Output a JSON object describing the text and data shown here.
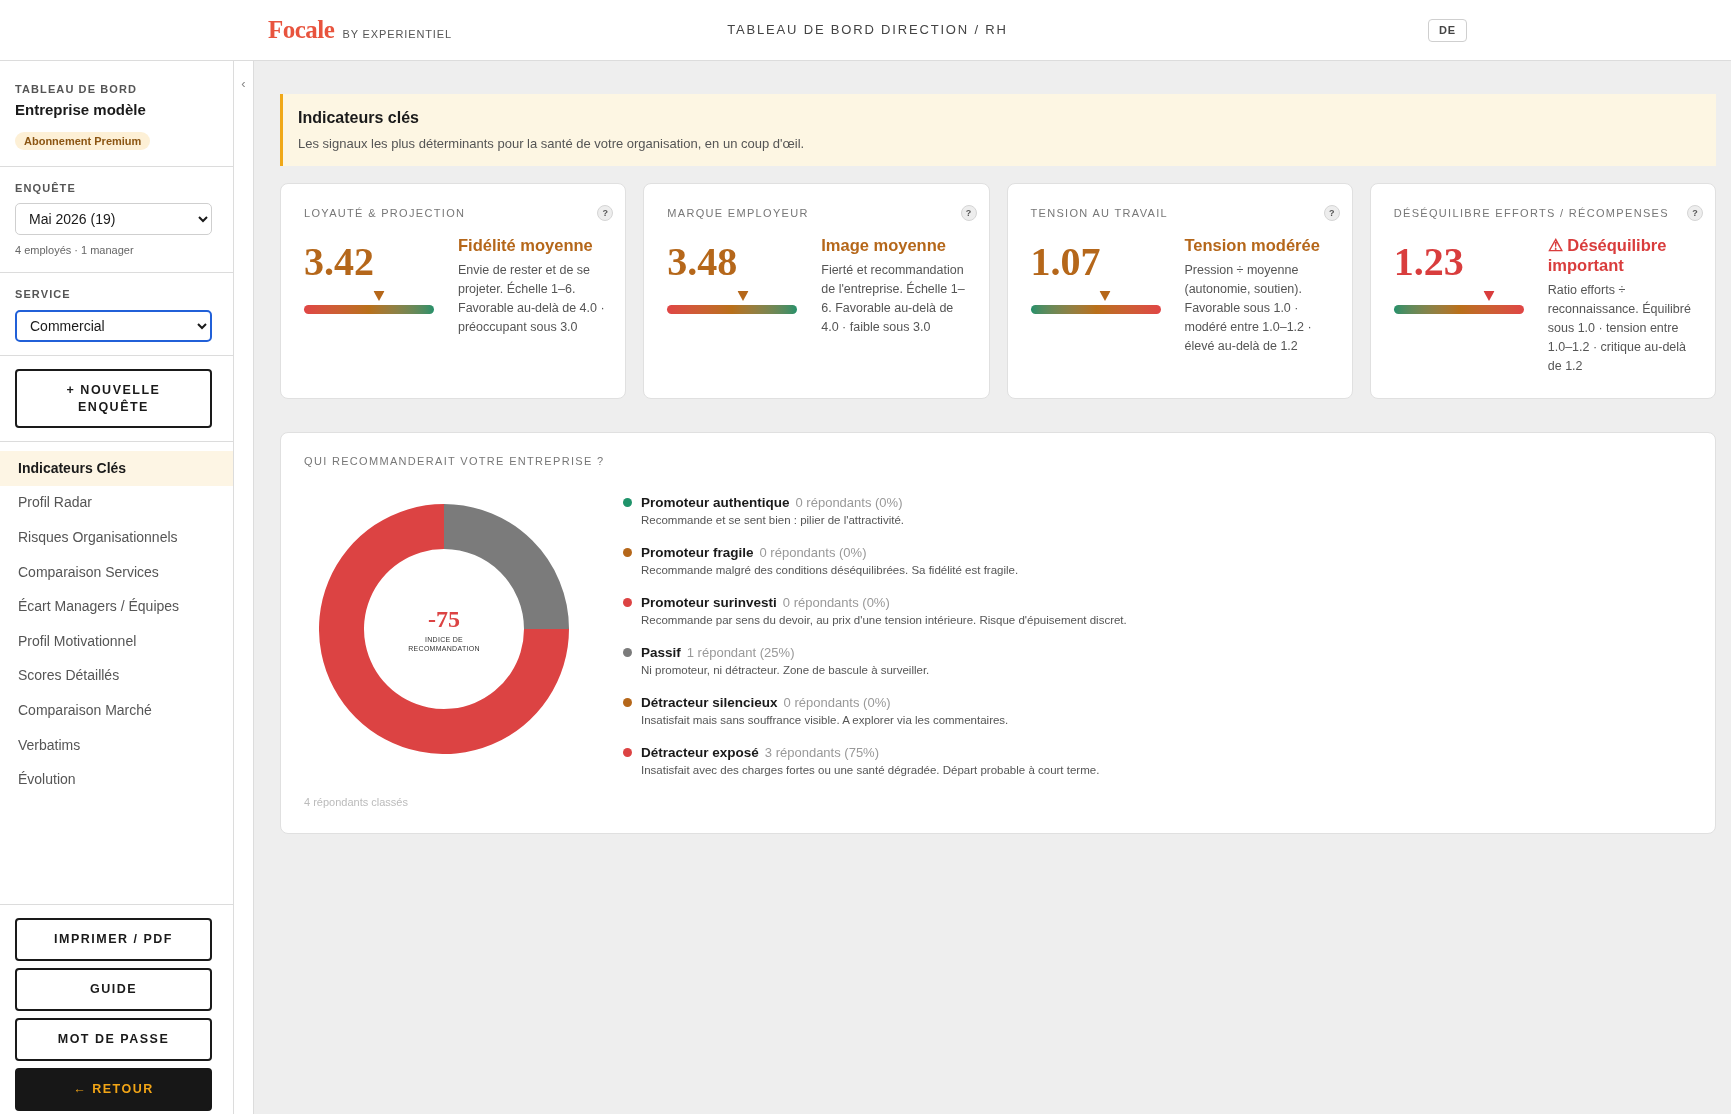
{
  "header": {
    "logo": "Focale",
    "logo_tagline": "BY EXPERIENTIEL",
    "title": "TABLEAU DE BORD DIRECTION / RH",
    "language_button": "DE"
  },
  "sidebar": {
    "eyebrow": "TABLEAU DE BORD",
    "company": "Entreprise modèle",
    "plan_badge": "Abonnement Premium",
    "survey": {
      "label": "ENQUÊTE",
      "value": "Mai 2026 (19)",
      "focused": false,
      "note": "4 employés · 1 manager"
    },
    "service": {
      "label": "SERVICE",
      "value": "Commercial",
      "focused": true
    },
    "new_survey_button": "+ NOUVELLE ENQUÊTE",
    "nav_items": [
      {
        "label": "Indicateurs Clés",
        "selected": true
      },
      {
        "label": "Profil Radar",
        "selected": false
      },
      {
        "label": "Risques Organisationnels",
        "selected": false
      },
      {
        "label": "Comparaison Services",
        "selected": false
      },
      {
        "label": "Écart Managers / Équipes",
        "selected": false
      },
      {
        "label": "Profil Motivationnel",
        "selected": false
      },
      {
        "label": "Scores Détaillés",
        "selected": false
      },
      {
        "label": "Comparaison Marché",
        "selected": false
      },
      {
        "label": "Verbatims",
        "selected": false
      },
      {
        "label": "Évolution",
        "selected": false
      }
    ],
    "actions": [
      {
        "label": "IMPRIMER / PDF",
        "kind": "outline"
      },
      {
        "label": "GUIDE",
        "kind": "outline"
      },
      {
        "label": "MOT DE PASSE",
        "kind": "outline"
      },
      {
        "label": "← RETOUR",
        "kind": "dark"
      }
    ]
  },
  "collapse_toggle": "‹",
  "banner": {
    "title": "Indicateurs clés",
    "subtitle": "Les signaux les plus déterminants pour la santé de votre organisation, en un coup d'œil."
  },
  "cards": [
    {
      "label": "LOYAUTÉ & PROJECTION",
      "help": "?",
      "value": "3.42",
      "status": "Fidélité moyenne",
      "description": "Envie de rester et de se projeter. Échelle 1–6. Favorable au-delà de 4.0 · préoccupant sous 3.0",
      "color": "#b5671a",
      "level": 0.58,
      "kind": "ascending"
    },
    {
      "label": "MARQUE EMPLOYEUR",
      "help": "?",
      "value": "3.48",
      "status": "Image moyenne",
      "description": "Fierté et recommandation de l'entreprise. Échelle 1–6. Favorable au-delà de 4.0 · faible sous 3.0",
      "color": "#b5671a",
      "level": 0.58,
      "kind": "ascending"
    },
    {
      "label": "TENSION AU TRAVAIL",
      "help": "?",
      "value": "1.07",
      "status": "Tension modérée",
      "description": "Pression ÷ moyenne (autonomie, soutien). Favorable sous 1.0 · modéré entre 1.0–1.2 · élevé au-delà de 1.2",
      "color": "#b5671a",
      "level": 0.57,
      "kind": "descending"
    },
    {
      "label": "DÉSÉQUILIBRE EFFORTS / RÉCOMPENSES",
      "help": "?",
      "value": "1.23",
      "status": "⚠ Déséquilibre important",
      "description": "Ratio efforts ÷ reconnaissance. Équilibré sous 1.0 · tension entre 1.0–1.2 · critique au-delà de 1.2",
      "color": "#d93d3d",
      "level": 0.73,
      "kind": "descending"
    }
  ],
  "recommendation": {
    "title": "QUI RECOMMANDERAIT VOTRE ENTREPRISE ?",
    "center_value": "-75",
    "center_label": "INDICE DE RECOMMANDATION",
    "chart_data": {
      "type": "donut",
      "categories": [
        "Promoteur authentique",
        "Promoteur fragile",
        "Promoteur surinvesti",
        "Passif",
        "Détracteur silencieux",
        "Détracteur exposé"
      ],
      "values": [
        0,
        0,
        0,
        25,
        0,
        75
      ]
    },
    "legend": [
      {
        "count": "0 répondants (0%)",
        "description": "Recommande et se sent bien : pilier de l'attractivité.",
        "color": "#1f936a"
      },
      {
        "count": "0 répondants (0%)",
        "description": "Recommande malgré des conditions déséquilibrées. Sa fidélité est fragile.",
        "color": "#b5671a"
      },
      {
        "count": "0 répondants (0%)",
        "description": "Recommande par sens du devoir, au prix d'une tension intérieure. Risque d'épuisement discret.",
        "color": "#dc4343"
      },
      {
        "count": "1 répondant (25%)",
        "description": "Ni promoteur, ni détracteur. Zone de bascule à surveiller.",
        "color": "#7b7b7b"
      },
      {
        "count": "0 répondants (0%)",
        "description": "Insatisfait mais sans souffrance visible. A explorer via les commentaires.",
        "color": "#b5671a"
      },
      {
        "count": "3 répondants (75%)",
        "description": "Insatisfait avec des charges fortes ou une santé dégradée. Départ probable à court terme.",
        "color": "#dc4343"
      }
    ],
    "footer": "4 répondants classés"
  }
}
